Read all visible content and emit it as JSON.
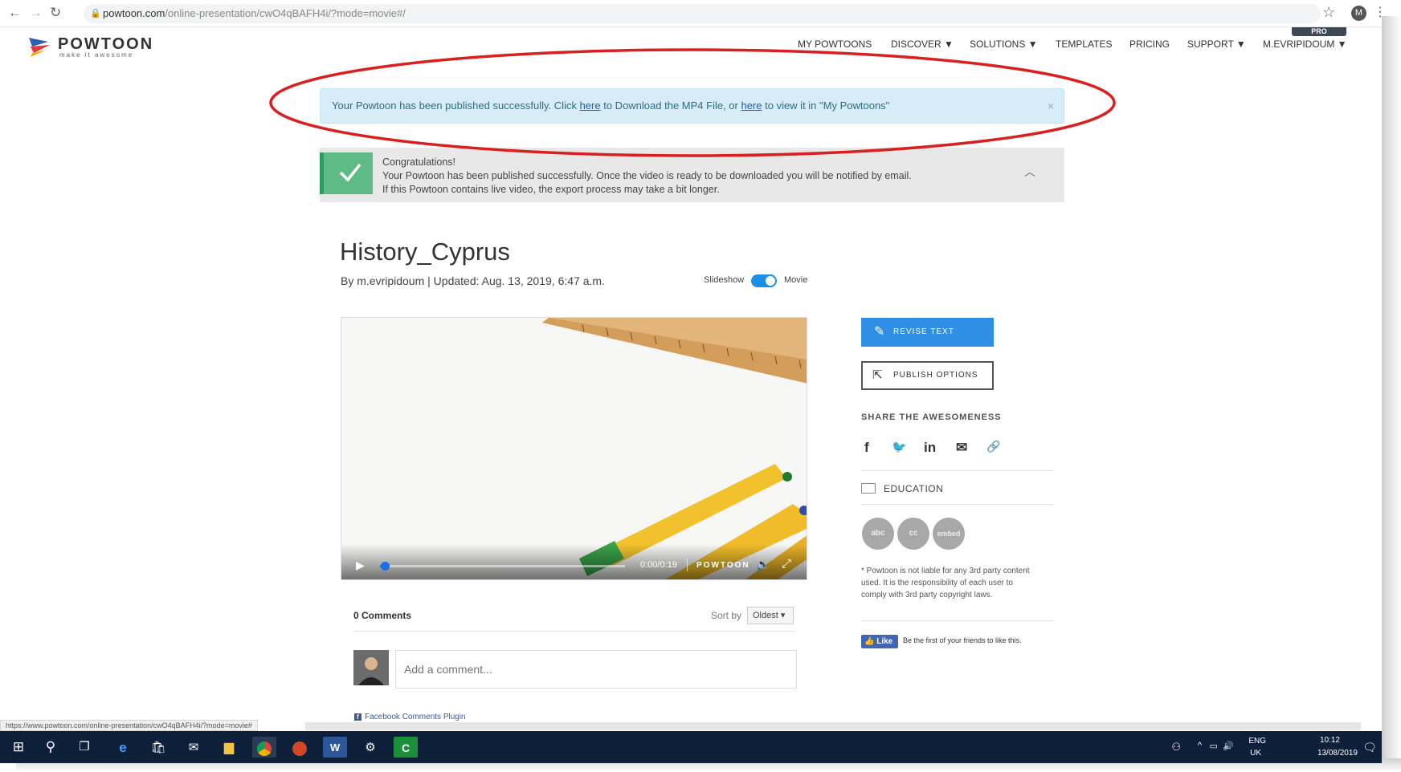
{
  "browser": {
    "url_host": "powtoon.com",
    "url_path": "/online-presentation/cwO4qBAFH4i/?mode=movie#/",
    "profile_initial": "M"
  },
  "header": {
    "logo_word": "POWTOON",
    "logo_tag": "make it awesome",
    "nav": [
      "MY POWTOONS",
      "DISCOVER ▼",
      "SOLUTIONS ▼",
      "TEMPLATES",
      "PRICING",
      "SUPPORT ▼",
      "M.EVRIPIDOUM ▼"
    ],
    "pro_badge": "PRO"
  },
  "alert_info": {
    "text1": "Your Powtoon has been published successfully. Click ",
    "link1": "here",
    "text2": " to Download the MP4 File, or ",
    "link2": "here",
    "text3": " to view it in \"My Powtoons\"",
    "close": "×"
  },
  "alert_congrats": {
    "line1": "Congratulations!",
    "line2": "Your Powtoon has been published successfully. Once the video is ready to be downloaded you will be notified by email.",
    "line3": "If this Powtoon contains live video, the export process may take a bit longer.",
    "chevron": "︿"
  },
  "powtoon": {
    "title": "History_Cyprus",
    "byline": "By m.evripidoum  |  Updated: Aug. 13, 2019, 6:47 a.m.",
    "toggle_left": "Slideshow",
    "toggle_right": "Movie",
    "toggle_on": true
  },
  "video": {
    "play": "▶",
    "time": "0:00/0:19",
    "logo": "POWTOON",
    "volume": "🔈",
    "fullscreen": "⤢",
    "progress": 0.02
  },
  "comments": {
    "count": "0 Comments",
    "sort_label": "Sort by",
    "sort_value": "Oldest ▾",
    "placeholder": "Add a comment...",
    "plugin": "Facebook Comments Plugin"
  },
  "sidebar": {
    "revise_label": "REVISE TEXT",
    "publish_label": "PUBLISH OPTIONS",
    "share_heading": "SHARE THE AWESOMENESS",
    "share": [
      "f",
      "🐦",
      "in",
      "✉",
      "🔗"
    ],
    "category": "EDUCATION",
    "circles": [
      "abc",
      "cc",
      "embed"
    ],
    "disclaimer": "* Powtoon is not liable for any 3rd party content used. It is the responsibility of each user to comply with 3rd party copyright laws.",
    "like_label": "Like",
    "like_text": "Be the first of your friends to like this."
  },
  "statusbar": {
    "url": "https://www.powtoon.com/online-presentation/cwO4qBAFH4i/?mode=movie#"
  },
  "taskbar": {
    "tray_lang1": "ENG",
    "tray_lang2": "UK",
    "time": "10:12",
    "date": "13/08/2019"
  },
  "colors": {
    "accent": "#2f8fe5",
    "alert_info_bg": "#d6ecf6",
    "success": "#5fbb85",
    "annotation": "#d9201e",
    "taskbar": "#0e1f3a"
  }
}
